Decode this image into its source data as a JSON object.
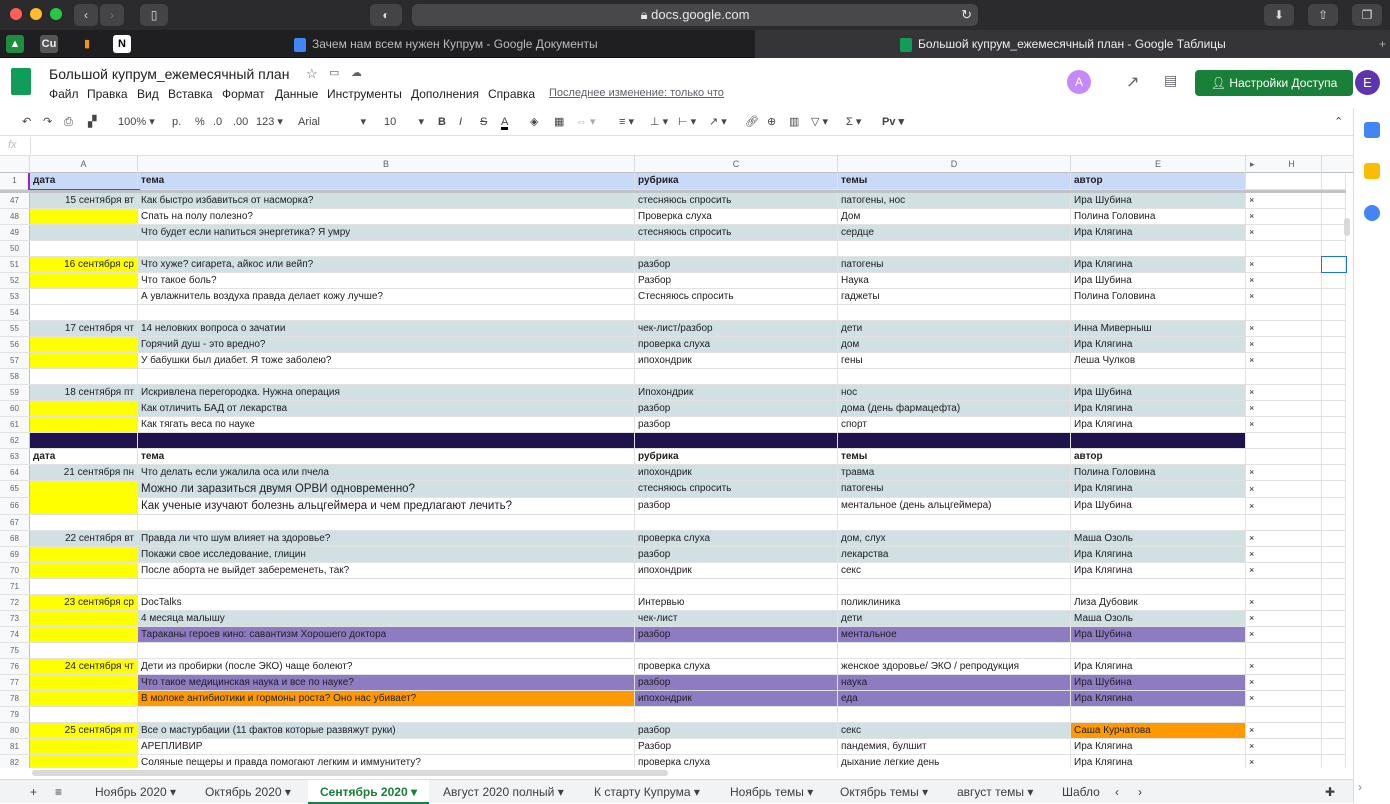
{
  "browser": {
    "url": "docs.google.com",
    "tabs": [
      {
        "label": "Зачем нам всем нужен Купрум - Google Документы"
      },
      {
        "label": "Большой купрум_ежемесячный план - Google Таблицы"
      }
    ],
    "favorites": [
      "Cu"
    ]
  },
  "doc": {
    "title": "Большой купрум_ежемесячный план",
    "menu": [
      "Файл",
      "Правка",
      "Вид",
      "Вставка",
      "Формат",
      "Данные",
      "Инструменты",
      "Дополнения",
      "Справка"
    ],
    "last_edit": "Последнее изменение: только что",
    "share_label": "Настройки Доступа",
    "avatar_letter": "E",
    "collab_letter": "A"
  },
  "toolbar": {
    "zoom": "100%",
    "currency": "р.",
    "percent": "%",
    "dec_less": ".0",
    "dec_more": ".00",
    "format_more": "123",
    "font": "Arial",
    "size": "10",
    "text_color_letter": "A",
    "script_label": "Рv",
    "fx": "fx"
  },
  "columns": [
    "A",
    "B",
    "C",
    "D",
    "E",
    "H"
  ],
  "rows": [
    {
      "n": "1",
      "a": "дата",
      "b": "тема",
      "c": "рубрика",
      "d": "темы",
      "e": "автор",
      "f": "",
      "style": "header"
    },
    {
      "n": "47",
      "a": "15 сентября вт",
      "b": "Как быстро избавиться от насморка?",
      "c": "стесняюсь спросить",
      "d": "патогены, нос",
      "e": "Ира Шубина",
      "f": "×",
      "style": "blue"
    },
    {
      "n": "48",
      "a": "",
      "b": "Спать на полу полезно?",
      "c": "Проверка слуха",
      "d": "Дом",
      "e": "Полина Головина",
      "f": "×",
      "style": "white",
      "aYellow": true
    },
    {
      "n": "49",
      "a": "",
      "b": "Что будет если напиться энергетика? Я умру",
      "c": "стесняюсь спросить",
      "d": "сердце",
      "e": "Ира Клягина",
      "f": "×",
      "style": "blue"
    },
    {
      "n": "50",
      "a": "",
      "b": "",
      "c": "",
      "d": "",
      "e": "",
      "f": "",
      "style": "empty"
    },
    {
      "n": "51",
      "a": "16 сентября ср",
      "b": "Что хуже? сигарета, айкос или вейп?",
      "c": "разбор",
      "d": "патогены",
      "e": "Ира Клягина",
      "f": "×",
      "style": "blue",
      "aYellow": true
    },
    {
      "n": "52",
      "a": "",
      "b": "Что такое боль?",
      "c": "Разбор",
      "d": "Наука",
      "e": "Ира Шубина",
      "f": "×",
      "style": "white",
      "aYellow": true
    },
    {
      "n": "53",
      "a": "",
      "b": "А увлажнитель воздуха правда делает кожу лучше?",
      "c": "Стесняюсь спросить",
      "d": "гаджеты",
      "e": "Полина Головина",
      "f": "×",
      "style": "white"
    },
    {
      "n": "54",
      "a": "",
      "b": "",
      "c": "",
      "d": "",
      "e": "",
      "f": "",
      "style": "empty"
    },
    {
      "n": "55",
      "a": "17 сентября чт",
      "b": "14 неловких вопроса о зачатии",
      "c": "чек-лист/разбор",
      "d": "дети",
      "e": "Инна Миверныш",
      "f": "×",
      "style": "blue"
    },
    {
      "n": "56",
      "a": "",
      "b": "Горячий душ - это вредно?",
      "c": "проверка слуха",
      "d": "дом",
      "e": "Ира Клягина",
      "f": "×",
      "style": "blue",
      "aYellow": true
    },
    {
      "n": "57",
      "a": "",
      "b": "У бабушки был диабет. Я тоже заболею?",
      "c": "ипохондрик",
      "d": "гены",
      "e": "Леша Чулков",
      "f": "×",
      "style": "white",
      "aYellow": true
    },
    {
      "n": "58",
      "a": "",
      "b": "",
      "c": "",
      "d": "",
      "e": "",
      "f": "",
      "style": "empty"
    },
    {
      "n": "59",
      "a": "18 сентября пт",
      "b": "Искривлена перегородка. Нужна операция",
      "c": "Ипохондрик",
      "d": "нос",
      "e": "Ира Шубина",
      "f": "×",
      "style": "blue"
    },
    {
      "n": "60",
      "a": "",
      "b": "Как отличить БАД от лекарства",
      "c": "разбор",
      "d": "дома (день фармацефта)",
      "e": "Ира Клягина",
      "f": "×",
      "style": "blue",
      "aYellow": true
    },
    {
      "n": "61",
      "a": "",
      "b": "Как тягать веса по науке",
      "c": "разбор",
      "d": "спорт",
      "e": "Ира Клягина",
      "f": "×",
      "style": "white",
      "aYellow": true
    },
    {
      "n": "62",
      "a": "",
      "b": "",
      "c": "",
      "d": "",
      "e": "",
      "f": "",
      "style": "purple"
    },
    {
      "n": "63",
      "a": "дата",
      "b": "тема",
      "c": "рубрика",
      "d": "темы",
      "e": "автор",
      "f": "",
      "style": "boldwhite"
    },
    {
      "n": "64",
      "a": "21 сентября пн",
      "b": "Что делать если ужалила оса или пчела",
      "c": "ипохондрик",
      "d": "травма",
      "e": "Полина Головина",
      "f": "×",
      "style": "blue"
    },
    {
      "n": "65",
      "a": "",
      "b": "Можно ли заразиться двумя ОРВИ одновременно?",
      "c": "стесняюсь спросить",
      "d": "патогены",
      "e": "Ира Клягина",
      "f": "×",
      "style": "blue",
      "aYellow": true,
      "big": true
    },
    {
      "n": "66",
      "a": "",
      "b": "Как ученые изучают болезнь альцгеймера и чем предлагают лечить?",
      "c": "разбор",
      "d": "ментальное (день альцгеймера)",
      "e": "Ира Шубина",
      "f": "×",
      "style": "white",
      "aYellow": true,
      "big": true
    },
    {
      "n": "67",
      "a": "",
      "b": "",
      "c": "",
      "d": "",
      "e": "",
      "f": "",
      "style": "empty"
    },
    {
      "n": "68",
      "a": "22 сентября вт",
      "b": "Правда ли что шум влияет на здоровье?",
      "c": "проверка слуха",
      "d": "дом, слух",
      "e": "Маша Озоль",
      "f": "×",
      "style": "blue"
    },
    {
      "n": "69",
      "a": "",
      "b": "Покажи свое исследование, глицин",
      "c": "разбор",
      "d": "лекарства",
      "e": "Ира Клягина",
      "f": "×",
      "style": "blue",
      "aYellow": true
    },
    {
      "n": "70",
      "a": "",
      "b": "После аборта не выйдет забеременеть, так?",
      "c": "ипохондрик",
      "d": "секс",
      "e": "Ира Клягина",
      "f": "×",
      "style": "white",
      "aYellow": true
    },
    {
      "n": "71",
      "a": "",
      "b": "",
      "c": "",
      "d": "",
      "e": "",
      "f": "",
      "style": "empty"
    },
    {
      "n": "72",
      "a": "23 сентября ср",
      "b": "DocTalks",
      "c": "Интервью",
      "d": "поликлиника",
      "e": "Лиза Дубовик",
      "f": "×",
      "style": "white",
      "aYellow": true
    },
    {
      "n": "73",
      "a": "",
      "b": "4 месяца малышу",
      "c": "чек-лист",
      "d": "дети",
      "e": "Маша Озоль",
      "f": "×",
      "style": "blue",
      "aYellow": true
    },
    {
      "n": "74",
      "a": "",
      "b": "Тараканы героев кино: савантизм Хорошего доктора",
      "c": "разбор",
      "d": "ментальное",
      "e": "Ира Шубина",
      "f": "×",
      "style": "lilac",
      "aYellow": true
    },
    {
      "n": "75",
      "a": "",
      "b": "",
      "c": "",
      "d": "",
      "e": "",
      "f": "",
      "style": "empty"
    },
    {
      "n": "76",
      "a": "24 сентября чт",
      "b": "Дети из пробирки (после ЭКО) чаще болеют?",
      "c": "проверка слуха",
      "d": "женское здоровье/ ЭКО / репродукция",
      "e": "Ира Клягина",
      "f": "×",
      "style": "white",
      "aYellow": true
    },
    {
      "n": "77",
      "a": "",
      "b": "Что такое медицинская наука и все по науке?",
      "c": "разбор",
      "d": "наука",
      "e": "Ира Шубина",
      "f": "×",
      "style": "lilac",
      "aYellow": true
    },
    {
      "n": "78",
      "a": "",
      "b": "В молоке антибиотики и гормоны роста? Оно нас убивает?",
      "c": "ипохондрик",
      "d": "еда",
      "e": "Ира Клягина",
      "f": "×",
      "style": "orangeb",
      "aYellow": true
    },
    {
      "n": "79",
      "a": "",
      "b": "",
      "c": "",
      "d": "",
      "e": "",
      "f": "",
      "style": "empty"
    },
    {
      "n": "80",
      "a": "25 сентября пт",
      "b": "Все о мастурбации (11 фактов которые развяжут руки)",
      "c": "разбор",
      "d": "секс",
      "e": "Саша Курчатова",
      "f": "×",
      "style": "blue",
      "aYellow": true,
      "eOrange": true
    },
    {
      "n": "81",
      "a": "",
      "b": "АРЕПЛИВИР",
      "c": "Разбор",
      "d": "пандемия, булшит",
      "e": "Ира Клягина",
      "f": "×",
      "style": "white",
      "aYellow": true
    },
    {
      "n": "82",
      "a": "",
      "b": "Соляные пещеры и правда помогают легким и иммунитету?",
      "c": "проверка слуха",
      "d": "дыхание легкие день",
      "e": "Ира Клягина",
      "f": "×",
      "style": "white",
      "aYellow": true
    }
  ],
  "sheet_tabs": [
    "Ноябрь 2020",
    "Октябрь 2020",
    "Сентябрь 2020",
    "Август 2020 полный",
    "К старту Купрума",
    "Ноябрь темы",
    "Октябрь темы",
    "август темы",
    "Шабло"
  ],
  "colors": {
    "blue": "#d0e0e3",
    "yellow": "#ffff00",
    "header": "#c9daf8",
    "purple": "#20124d",
    "lilac": "#8e7cc3",
    "orange": "#ff9900",
    "accent": "#188038"
  }
}
